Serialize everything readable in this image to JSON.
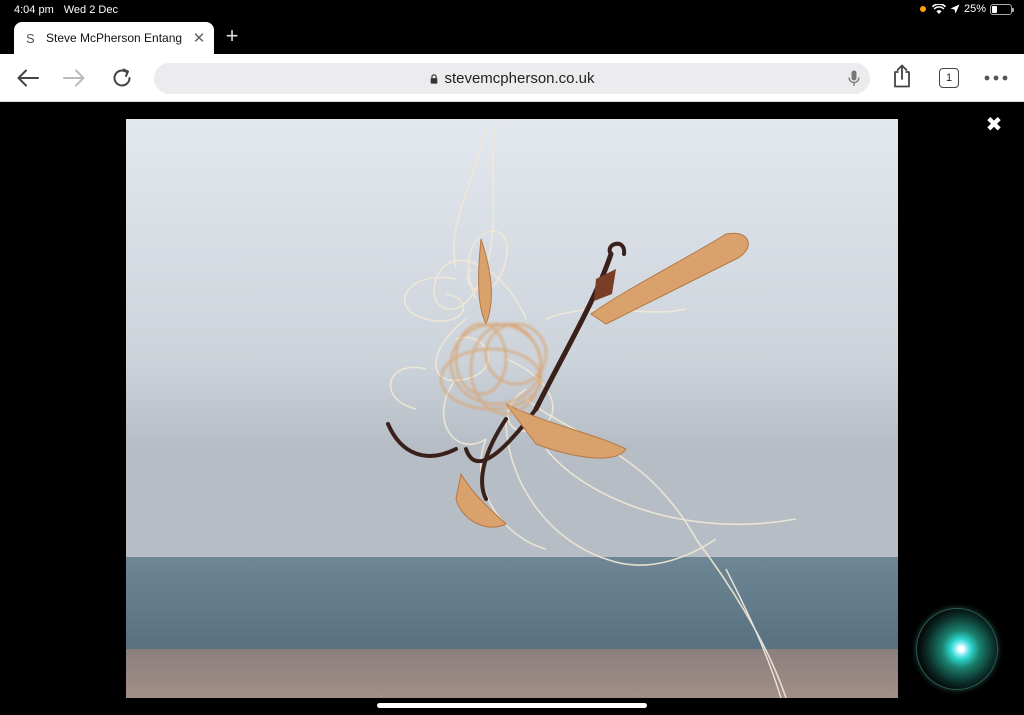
{
  "status_bar": {
    "time": "4:04 pm",
    "date": "Wed 2 Dec",
    "battery": "25%",
    "battery_level": 0.25
  },
  "tabs": [
    {
      "favicon_letter": "S",
      "title": "Steve McPherson Entang"
    }
  ],
  "toolbar": {
    "url": "stevemcpherson.co.uk",
    "tab_count": "1"
  },
  "icons": {
    "back": "back-arrow-icon",
    "forward": "forward-arrow-icon",
    "reload": "reload-icon",
    "lock": "lock-icon",
    "mic": "microphone-icon",
    "share": "share-icon",
    "tabs": "tabs-icon",
    "more": "more-icon",
    "close": "close-icon"
  },
  "colors": {
    "background": "#000000",
    "toolbar": "#ffffff",
    "url_bar": "#ececee"
  }
}
